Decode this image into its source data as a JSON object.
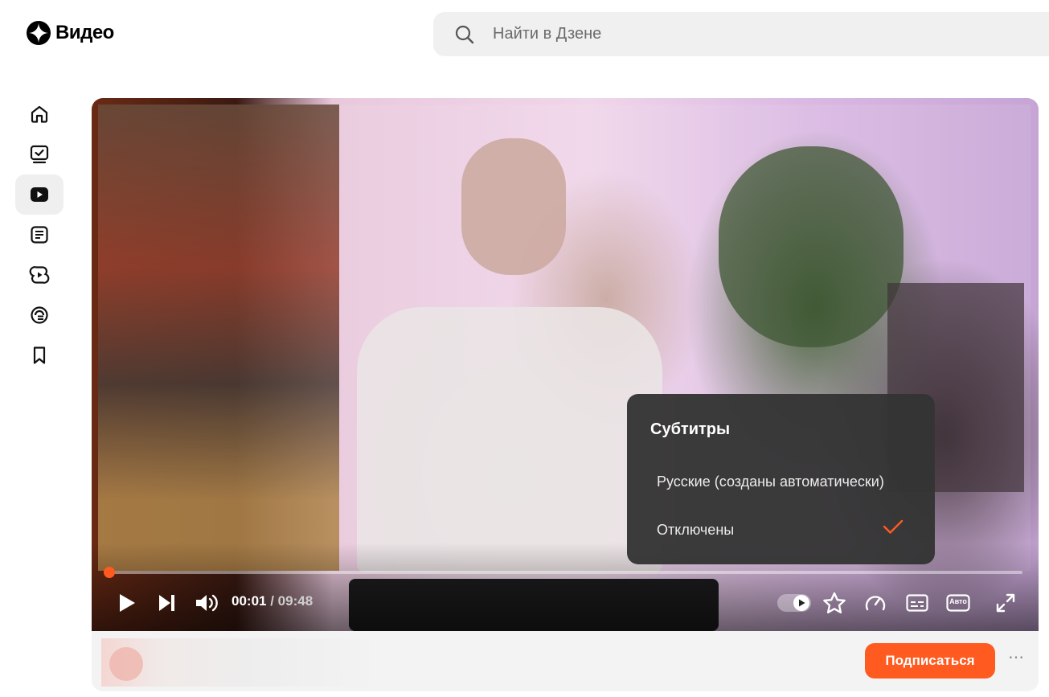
{
  "header": {
    "logo_text": "Видео",
    "logo_icon": "zen-star-icon",
    "search_placeholder": "Найти в Дзене"
  },
  "sidebar": {
    "items": [
      {
        "icon": "home-icon",
        "active": false
      },
      {
        "icon": "checklist-tv-icon",
        "active": false
      },
      {
        "icon": "video-play-icon",
        "active": true
      },
      {
        "icon": "article-icon",
        "active": false
      },
      {
        "icon": "shorts-icon",
        "active": false
      },
      {
        "icon": "communities-icon",
        "active": false
      },
      {
        "icon": "bookmark-icon",
        "active": false
      }
    ]
  },
  "player": {
    "current_time": "00:01",
    "duration": "/ 09:48",
    "progress_fraction": 0.0017,
    "accent_color": "#ff5a1f",
    "controls": [
      "play-icon",
      "next-icon",
      "volume-icon",
      "autoplay-toggle",
      "star-icon",
      "speed-icon",
      "subtitles-icon",
      "quality-auto-icon",
      "fullscreen-icon"
    ],
    "quality_label": "Авто",
    "subtitles_menu": {
      "title": "Субтитры",
      "options": [
        {
          "label": "Русские (созданы автоматически)",
          "selected": false
        },
        {
          "label": "Отключены",
          "selected": true
        }
      ]
    }
  },
  "channel": {
    "subscribe_label": "Подписаться",
    "more_label": "⋯"
  }
}
